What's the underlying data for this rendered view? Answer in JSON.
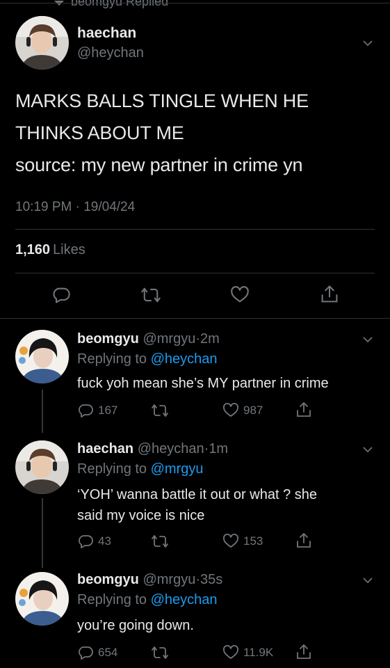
{
  "context": {
    "label": "beomgyu Replied"
  },
  "main_tweet": {
    "name": "haechan",
    "handle": "@heychan",
    "text_lines": [
      "MARKS BALLS TINGLE WHEN HE",
      "THINKS ABOUT ME",
      "source: my new partner in crime yn"
    ],
    "time": "10:19 PM",
    "sep": "·",
    "date": "19/04/24",
    "likes_count": "1,160",
    "likes_label": "Likes",
    "actions": [
      "reply-icon",
      "retweet-icon",
      "like-icon",
      "share-icon"
    ]
  },
  "replies": [
    {
      "name": "beomgyu",
      "handle": "@mrgyu",
      "sep": "·",
      "time": "2m",
      "replying_prefix": "Replying to",
      "replying_to": "@heychan",
      "text_lines": [
        "fuck yoh mean she’s MY partner in crime"
      ],
      "reply_count": "167",
      "like_count": "987"
    },
    {
      "name": "haechan",
      "handle": "@heychan",
      "sep": "·",
      "time": "1m",
      "replying_prefix": "Replying to",
      "replying_to": "@mrgyu",
      "text_lines": [
        "‘YOH’ wanna battle it out or what ? she",
        "said my voice is nice"
      ],
      "reply_count": "43",
      "like_count": "153"
    },
    {
      "name": "beomgyu",
      "handle": "@mrgyu",
      "sep": "·",
      "time": "35s",
      "replying_prefix": "Replying to",
      "replying_to": "@heychan",
      "text_lines": [
        "you’re going down."
      ],
      "reply_count": "654",
      "like_count": "11.9K"
    }
  ],
  "colors": {
    "background": "#000000",
    "text": "#e7e9ea",
    "muted": "#71767b",
    "link": "#1d9bf0",
    "divider": "#2f3336"
  }
}
